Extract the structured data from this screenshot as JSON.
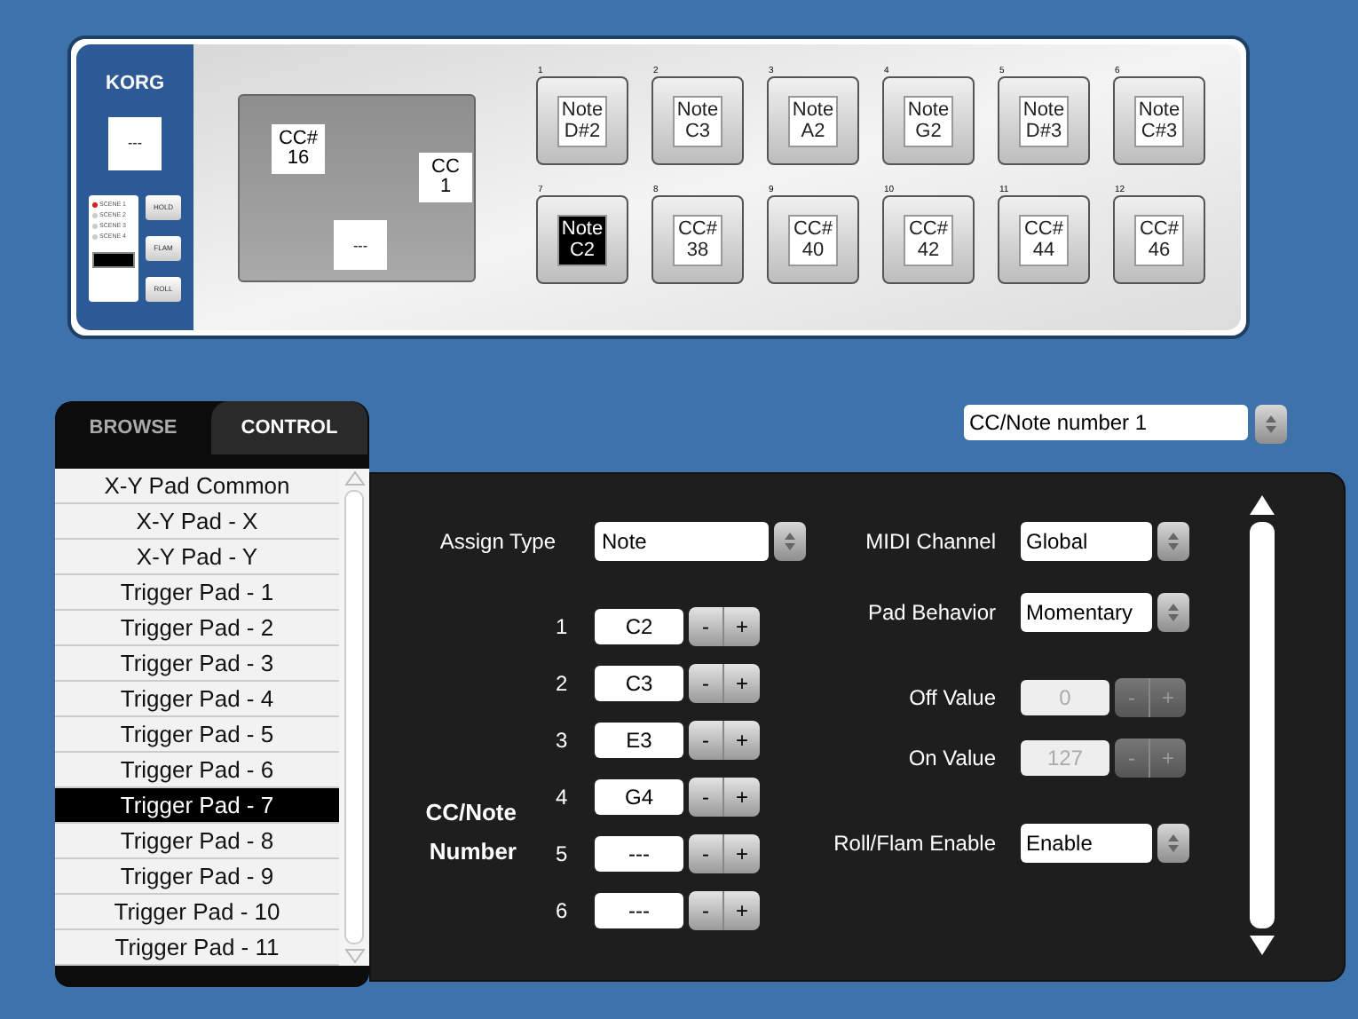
{
  "device": {
    "logo": "KORG",
    "display": "---",
    "scenes": [
      {
        "label": "SCENE 1",
        "selected": true
      },
      {
        "label": "SCENE 2",
        "selected": false
      },
      {
        "label": "SCENE 3",
        "selected": false
      },
      {
        "label": "SCENE 4",
        "selected": false
      }
    ],
    "buttons": [
      "HOLD",
      "FLAM",
      "ROLL"
    ],
    "xy_pad": {
      "labels": [
        {
          "line1": "CC#",
          "line2": "16"
        },
        {
          "line1": "CC",
          "line2": "1"
        },
        {
          "line1": "---"
        }
      ]
    },
    "pads": [
      {
        "number": "1",
        "type": "Note",
        "value": "D#2",
        "selected": false
      },
      {
        "number": "2",
        "type": "Note",
        "value": "C3",
        "selected": false
      },
      {
        "number": "3",
        "type": "Note",
        "value": "A2",
        "selected": false
      },
      {
        "number": "4",
        "type": "Note",
        "value": "G2",
        "selected": false
      },
      {
        "number": "5",
        "type": "Note",
        "value": "D#3",
        "selected": false
      },
      {
        "number": "6",
        "type": "Note",
        "value": "C#3",
        "selected": false
      },
      {
        "number": "7",
        "type": "Note",
        "value": "C2",
        "selected": true
      },
      {
        "number": "8",
        "type": "CC#",
        "value": "38",
        "selected": false
      },
      {
        "number": "9",
        "type": "CC#",
        "value": "40",
        "selected": false
      },
      {
        "number": "10",
        "type": "CC#",
        "value": "42",
        "selected": false
      },
      {
        "number": "11",
        "type": "CC#",
        "value": "44",
        "selected": false
      },
      {
        "number": "12",
        "type": "CC#",
        "value": "46",
        "selected": false
      }
    ]
  },
  "tabs": [
    {
      "label": "BROWSE",
      "selected": false
    },
    {
      "label": "CONTROL",
      "selected": true
    }
  ],
  "control_list": [
    {
      "label": "X-Y Pad Common",
      "selected": false
    },
    {
      "label": "X-Y Pad - X",
      "selected": false
    },
    {
      "label": "X-Y Pad - Y",
      "selected": false
    },
    {
      "label": "Trigger Pad - 1",
      "selected": false
    },
    {
      "label": "Trigger Pad - 2",
      "selected": false
    },
    {
      "label": "Trigger Pad - 3",
      "selected": false
    },
    {
      "label": "Trigger Pad - 4",
      "selected": false
    },
    {
      "label": "Trigger Pad - 5",
      "selected": false
    },
    {
      "label": "Trigger Pad - 6",
      "selected": false
    },
    {
      "label": "Trigger Pad - 7",
      "selected": true
    },
    {
      "label": "Trigger Pad - 8",
      "selected": false
    },
    {
      "label": "Trigger Pad - 9",
      "selected": false
    },
    {
      "label": "Trigger Pad - 10",
      "selected": false
    },
    {
      "label": "Trigger Pad - 11",
      "selected": false
    }
  ],
  "number_select": "CC/Note number 1",
  "settings": {
    "assign_type": {
      "label": "Assign Type",
      "value": "Note"
    },
    "cc_note_label": [
      "CC/Note",
      "Number"
    ],
    "numbers": [
      {
        "index": "1",
        "value": "C2",
        "minus": "-",
        "plus": "+"
      },
      {
        "index": "2",
        "value": "C3",
        "minus": "-",
        "plus": "+"
      },
      {
        "index": "3",
        "value": "E3",
        "minus": "-",
        "plus": "+"
      },
      {
        "index": "4",
        "value": "G4",
        "minus": "-",
        "plus": "+"
      },
      {
        "index": "5",
        "value": "---",
        "minus": "-",
        "plus": "+"
      },
      {
        "index": "6",
        "value": "---",
        "minus": "-",
        "plus": "+"
      }
    ],
    "right": [
      {
        "kind": "select",
        "label": "MIDI Channel",
        "value": "Global"
      },
      {
        "kind": "select",
        "label": "Pad Behavior",
        "value": "Momentary"
      },
      {
        "kind": "stepper",
        "label": "Off Value",
        "value": "0",
        "minus": "-",
        "plus": "+",
        "disabled": true
      },
      {
        "kind": "stepper",
        "label": "On Value",
        "value": "127",
        "minus": "-",
        "plus": "+",
        "disabled": true
      },
      {
        "kind": "select",
        "label": "Roll/Flam Enable",
        "value": "Enable"
      }
    ]
  }
}
